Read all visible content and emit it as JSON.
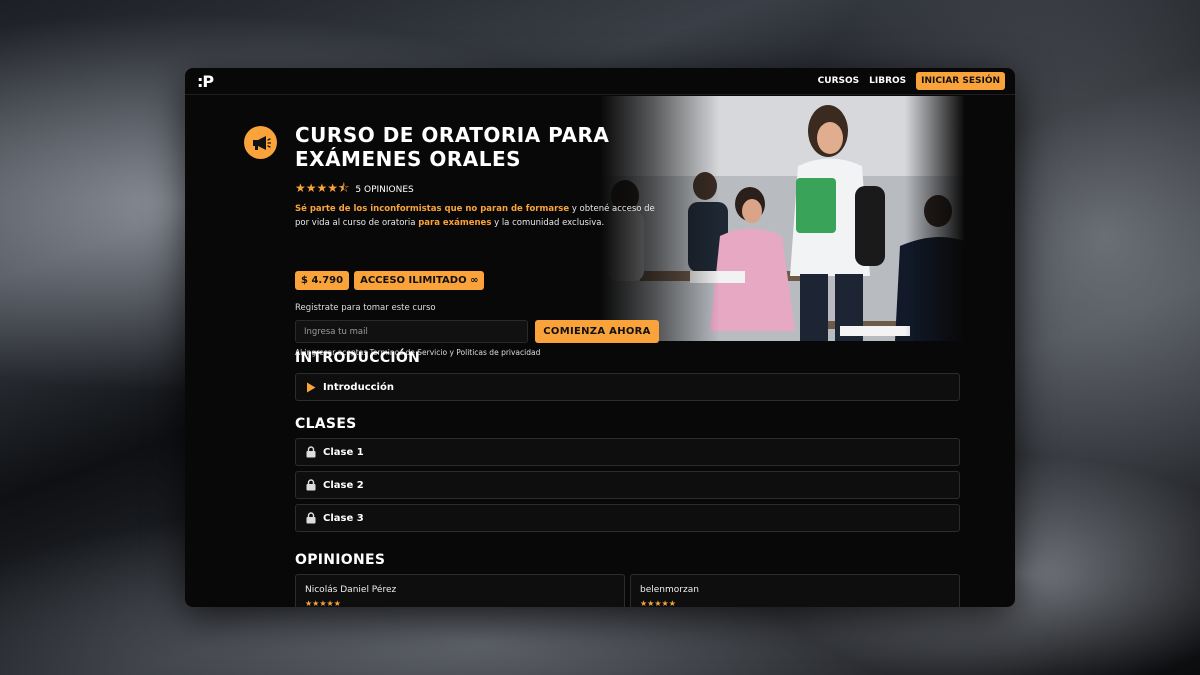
{
  "nav": {
    "logo": ":P",
    "links": [
      "CURSOS",
      "LIBROS"
    ],
    "login": "INICIAR SESIÓN"
  },
  "course": {
    "icon": "megaphone-icon",
    "title": "CURSO DE ORATORIA PARA EXÁMENES ORALES",
    "stars_display": "★★★★⯪",
    "rating_value": 4.5,
    "opinions": "5 OPINIONES",
    "desc_hl1": "Sé parte de los inconformistas que no paran de formarse",
    "desc_part2": " y obtené acceso de por vida al curso de oratoria ",
    "desc_hl2": "para exámenes",
    "desc_part3": " y la comunidad exclusiva.",
    "price": "$ 4.790",
    "access": "ACCESO ILIMITADO ∞",
    "register_label": "Registrate para tomar este curso",
    "email_placeholder": "Ingresa tu mail",
    "cta": "COMIENZA AHORA",
    "terms": "Al ingresar aceptas Terminos de Servicio y Politicas de privacidad"
  },
  "sections": {
    "intro_title": "INTRODUCCIÓN",
    "intro_items": [
      {
        "label": "Introducción",
        "icon": "play-icon"
      }
    ],
    "classes_title": "CLASES",
    "classes": [
      {
        "label": "Clase 1",
        "icon": "lock-icon"
      },
      {
        "label": "Clase 2",
        "icon": "lock-icon"
      },
      {
        "label": "Clase 3",
        "icon": "lock-icon"
      }
    ],
    "opinions_title": "OPINIONES"
  },
  "reviews": [
    {
      "name": "Nicolás Daniel Pérez",
      "stars": "★★★★★"
    },
    {
      "name": "belenmorzan",
      "stars": "★★★★★"
    }
  ],
  "colors": {
    "accent": "#f9a33a",
    "background": "#080808"
  }
}
